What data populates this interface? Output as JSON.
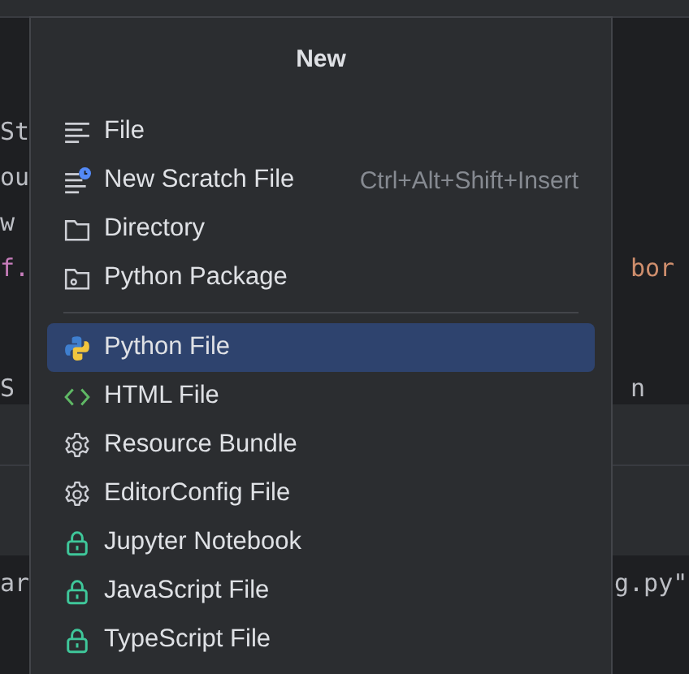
{
  "editor": {
    "top_lines": [
      {
        "left": "St"
      },
      {
        "left": "ou"
      },
      {
        "left": "w"
      },
      {
        "left": "f.",
        "right": "bor"
      }
    ],
    "cut_line": {
      "left": "S",
      "right": "n"
    },
    "bottom_line": {
      "left": "ar",
      "right": "g.py\""
    }
  },
  "popup": {
    "title": "New",
    "groups": [
      [
        {
          "kind": "file",
          "label": "File",
          "selected": false
        },
        {
          "kind": "scratch",
          "label": "New Scratch File",
          "shortcut": "Ctrl+Alt+Shift+Insert",
          "selected": false
        },
        {
          "kind": "folder",
          "label": "Directory",
          "selected": false
        },
        {
          "kind": "package",
          "label": "Python Package",
          "selected": false
        }
      ],
      [
        {
          "kind": "python",
          "label": "Python File",
          "selected": true
        },
        {
          "kind": "html",
          "label": "HTML File",
          "selected": false
        },
        {
          "kind": "gear",
          "label": "Resource Bundle",
          "selected": false
        },
        {
          "kind": "gear",
          "label": "EditorConfig File",
          "selected": false
        },
        {
          "kind": "lock",
          "label": "Jupyter Notebook",
          "selected": false
        },
        {
          "kind": "lock",
          "label": "JavaScript File",
          "selected": false
        },
        {
          "kind": "lock",
          "label": "TypeScript File",
          "selected": false
        }
      ]
    ]
  }
}
